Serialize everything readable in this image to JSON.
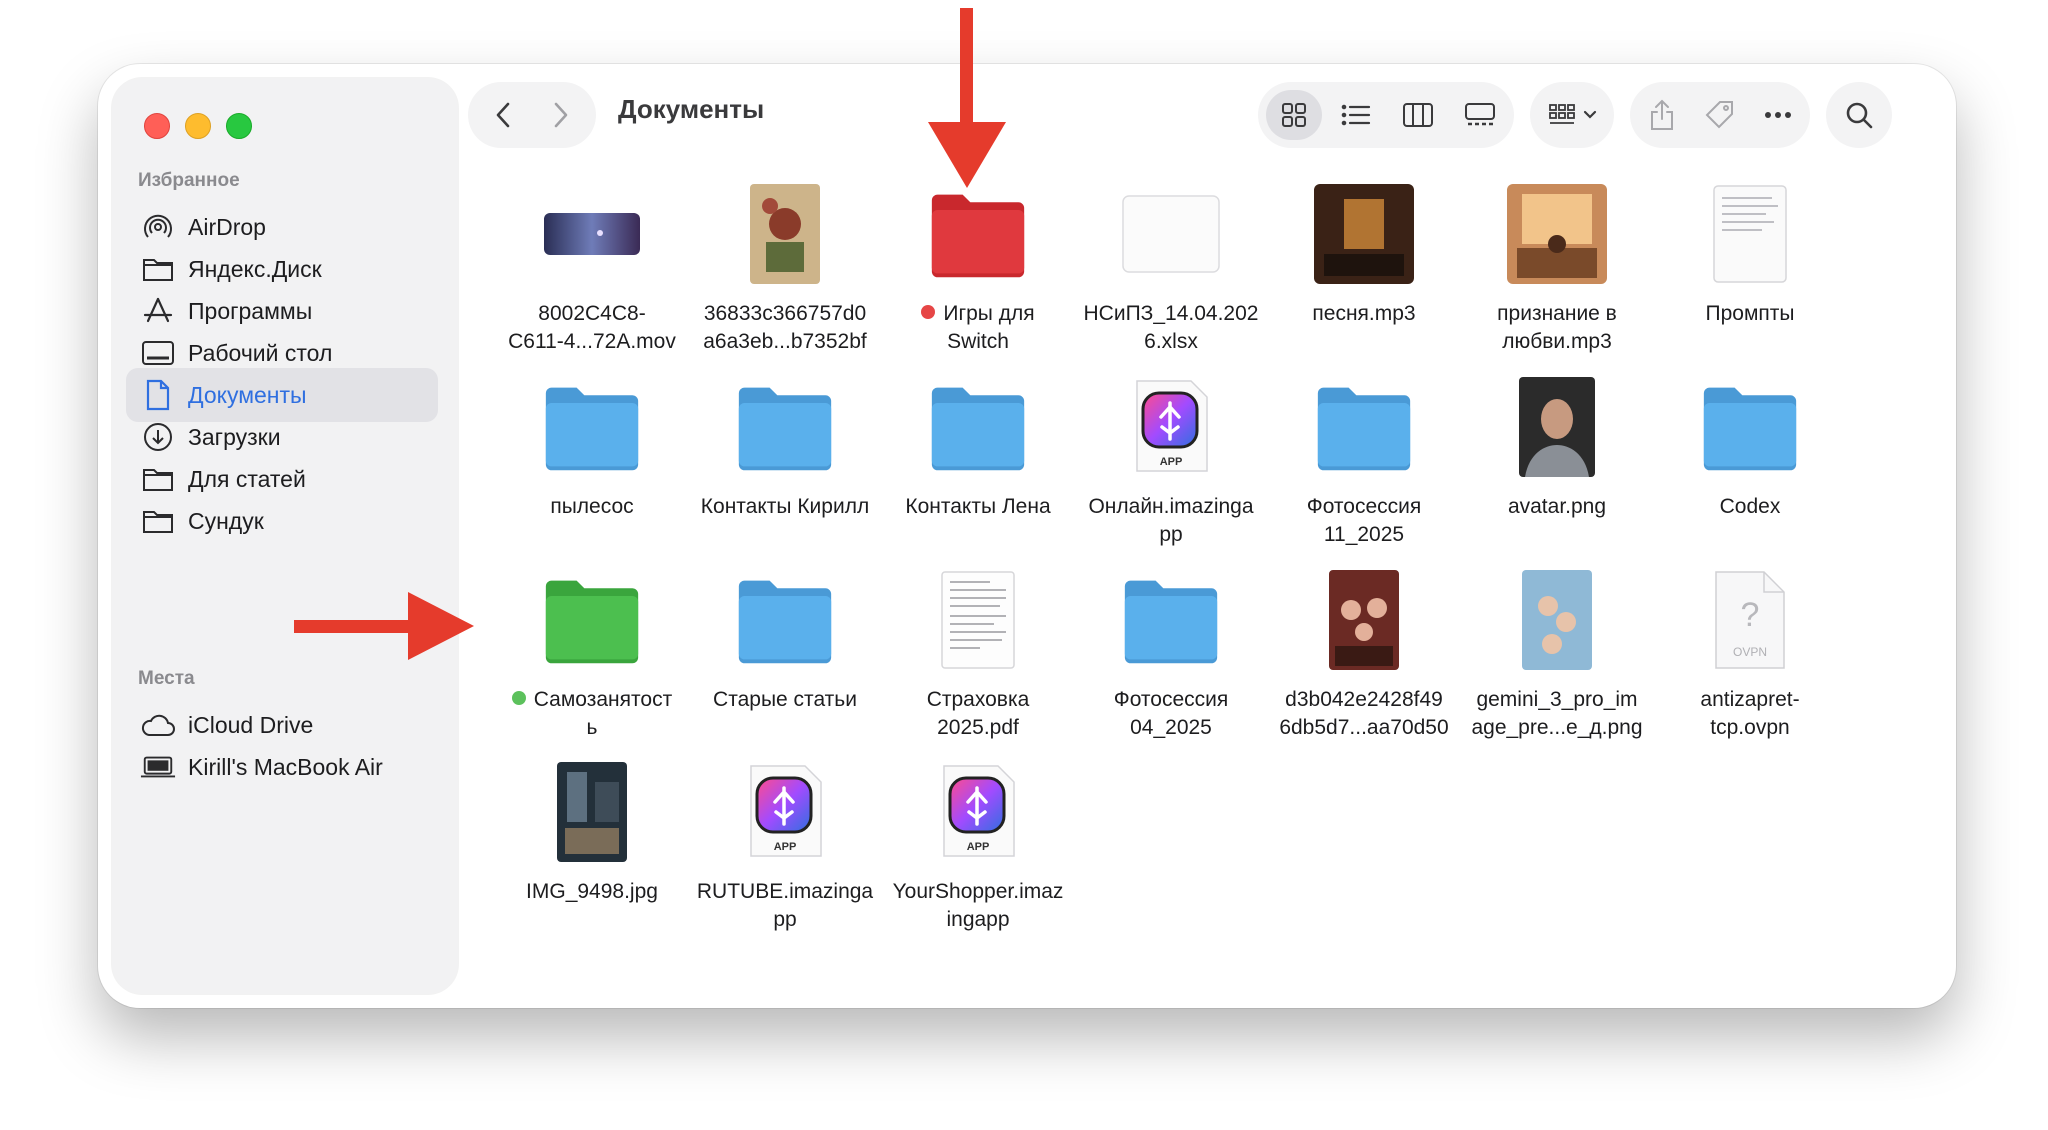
{
  "window": {
    "title": "Документы"
  },
  "sidebar": {
    "favorites_label": "Избранное",
    "places_label": "Места",
    "favorites": [
      {
        "label": "AirDrop",
        "icon": "airdrop-icon"
      },
      {
        "label": "Яндекс.Диск",
        "icon": "folder-icon"
      },
      {
        "label": "Программы",
        "icon": "apps-icon"
      },
      {
        "label": "Рабочий стол",
        "icon": "desktop-icon"
      },
      {
        "label": "Документы",
        "icon": "document-icon",
        "selected": true
      },
      {
        "label": "Загрузки",
        "icon": "download-icon"
      },
      {
        "label": "Для статей",
        "icon": "folder-icon"
      },
      {
        "label": "Сундук",
        "icon": "folder-icon"
      }
    ],
    "places": [
      {
        "label": "iCloud Drive",
        "icon": "cloud-icon"
      },
      {
        "label": "Kirill's MacBook Air",
        "icon": "laptop-icon"
      }
    ]
  },
  "colors": {
    "accent": "#2f6fe0",
    "folder_blue": "#5ab0ec",
    "folder_red": "#e0393e",
    "folder_green": "#4cbf4f",
    "arrow": "#e53b2c"
  },
  "files": [
    {
      "name": "8002C4C8-\nC611-4...72A.mov",
      "kind": "video"
    },
    {
      "name": "36833c366757d0\na6a3eb...b7352bf",
      "kind": "image-vintage"
    },
    {
      "name": "Игры для\nSwitch",
      "kind": "folder-red",
      "tag": "red"
    },
    {
      "name": "НСиПЗ_14.04.202\n6.xlsx",
      "kind": "blank"
    },
    {
      "name": "песня.mp3",
      "kind": "audio-dark"
    },
    {
      "name": "признание в\nлюбви.mp3",
      "kind": "audio-warm"
    },
    {
      "name": "Промпты",
      "kind": "doc"
    },
    {
      "name": "пылесос",
      "kind": "folder-blue"
    },
    {
      "name": "Контакты Кирилл",
      "kind": "folder-blue"
    },
    {
      "name": "Контакты Лена",
      "kind": "folder-blue"
    },
    {
      "name": "Онлайн.imazinga\npp",
      "kind": "app"
    },
    {
      "name": "Фотосессия\n11_2025",
      "kind": "folder-blue"
    },
    {
      "name": "avatar.png",
      "kind": "portrait"
    },
    {
      "name": "Codex",
      "kind": "folder-blue"
    },
    {
      "name": "Самозанятост\nь",
      "kind": "folder-green",
      "tag": "green"
    },
    {
      "name": "Старые статьи",
      "kind": "folder-blue"
    },
    {
      "name": "Страховка\n2025.pdf",
      "kind": "pdf"
    },
    {
      "name": "Фотосессия\n04_2025",
      "kind": "folder-blue"
    },
    {
      "name": "d3b042e2428f49\n6db5d7...aa70d50",
      "kind": "image-family"
    },
    {
      "name": "gemini_3_pro_im\nage_pre...e_д.png",
      "kind": "image-blue"
    },
    {
      "name": "antizapret-\ntcp.ovpn",
      "kind": "unknown"
    },
    {
      "name": "IMG_9498.jpg",
      "kind": "image-street"
    },
    {
      "name": "RUTUBE.imazinga\npp",
      "kind": "app"
    },
    {
      "name": "YourShopper.imaz\ningapp",
      "kind": "app"
    }
  ],
  "icon_labels": {
    "app_badge": "APP",
    "ovpn_badge": "OVPN",
    "unknown_mark": "?"
  }
}
